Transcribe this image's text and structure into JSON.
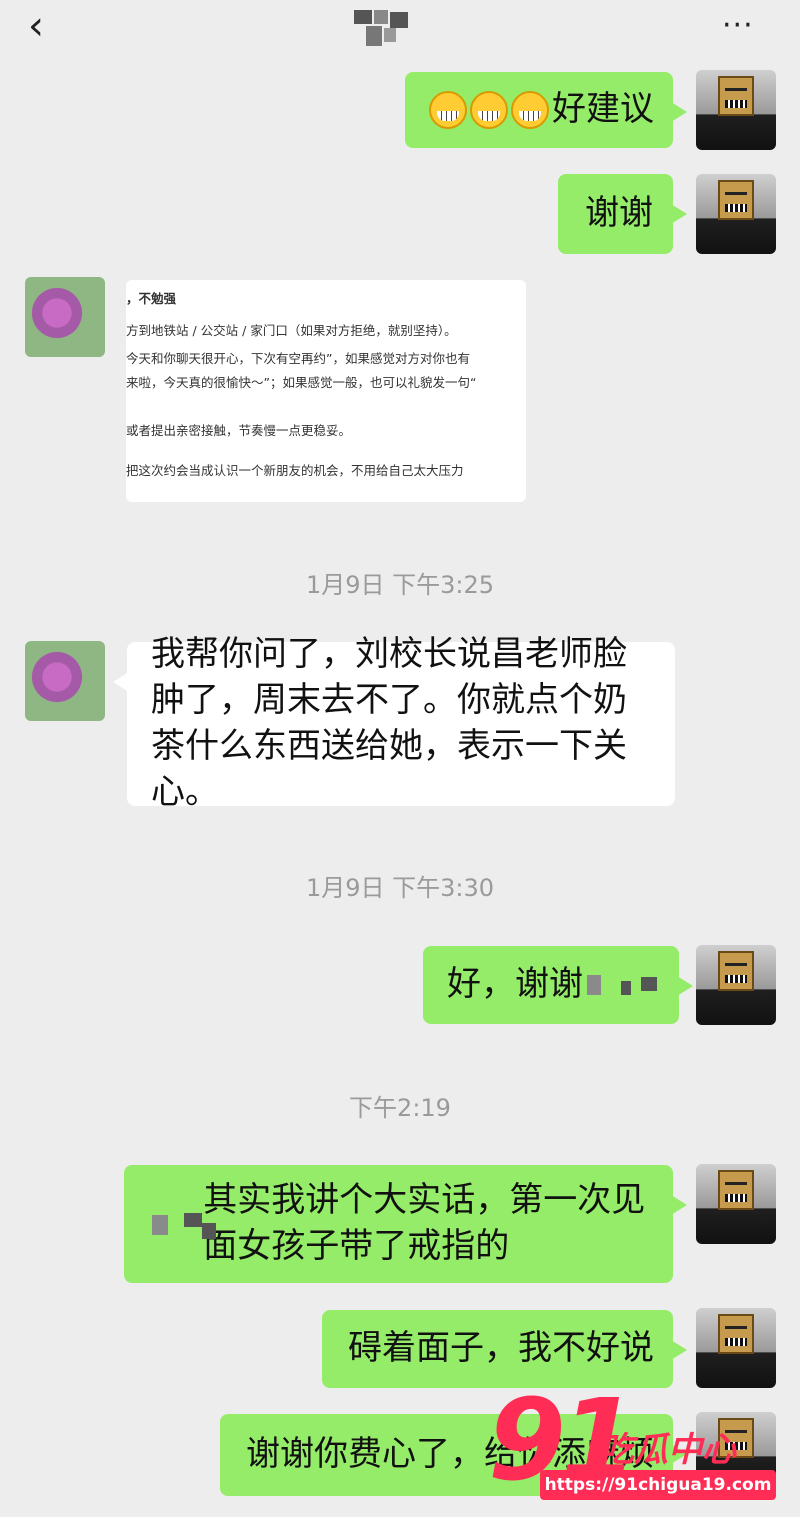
{
  "header": {
    "back_icon": "chevron-left-icon",
    "more_label": "···"
  },
  "messages": {
    "m1": "好建议",
    "m2": "谢谢",
    "card_lines": [
      "，不勉强",
      "方到地铁站 / 公交站 / 家门口（如果对方拒绝，就别坚持）。",
      "今天和你聊天很开心，下次有空再约”，如果感觉对方对你也有",
      "来啦，今天真的很愉快～”；如果感觉一般，也可以礼貌发一句“",
      "或者提出亲密接触，节奏慢一点更稳妥。",
      "把这次约会当成认识一个新朋友的机会，不用给自己太大压力"
    ],
    "t1": "1月9日 下午3:25",
    "m3": "我帮你问了，刘校长说昌老师脸肿了，周末去不了。你就点个奶茶什么东西送给她，表示一下关心。",
    "t2": "1月9日 下午3:30",
    "m4": "好，谢谢",
    "t3": "下午2:19",
    "m5": "其实我讲个大实话，第一次见面女孩子带了戒指的",
    "m6": "碍着面子，我不好说",
    "m7": "谢谢你费心了，给你添麻烦"
  },
  "watermark": {
    "big": "91",
    "text": "吃瓜中心",
    "url": "https://91chigua19.com"
  }
}
